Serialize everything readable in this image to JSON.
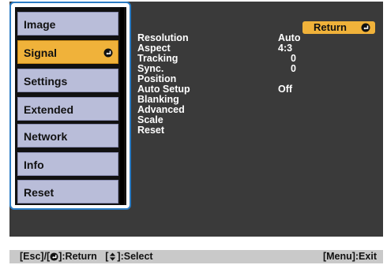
{
  "categories": [
    {
      "label": "Image",
      "selected": false
    },
    {
      "label": "Signal",
      "selected": true
    },
    {
      "label": "Settings",
      "selected": false
    },
    {
      "label": "Extended",
      "selected": false
    },
    {
      "label": "Network",
      "selected": false
    },
    {
      "label": "Info",
      "selected": false
    },
    {
      "label": "Reset",
      "selected": false
    }
  ],
  "return_button": {
    "label": "Return",
    "icon": "enter-icon"
  },
  "settings": [
    {
      "label": "Resolution",
      "value": "Auto"
    },
    {
      "label": "Aspect",
      "value": "4:3"
    },
    {
      "label": "Tracking",
      "value": "0"
    },
    {
      "label": "Sync.",
      "value": "0"
    },
    {
      "label": "Position",
      "value": ""
    },
    {
      "label": "Auto Setup",
      "value": "Off"
    },
    {
      "label": "Blanking",
      "value": ""
    },
    {
      "label": "Advanced",
      "value": ""
    },
    {
      "label": "Scale",
      "value": ""
    },
    {
      "label": "Reset",
      "value": ""
    }
  ],
  "footer": {
    "esc": "[Esc]",
    "enter_prefix": "/[",
    "enter_suffix": "]:Return",
    "select_prefix": "[",
    "select_suffix": "]:Select",
    "menu_exit": "[Menu]:Exit"
  },
  "colors": {
    "menu_background": "#3a3a3a",
    "category_item": "#b9bdd9",
    "selected_accent": "#f0b23a",
    "focus_border": "#2b7cc4",
    "footer_bar": "#c9c9c9"
  }
}
